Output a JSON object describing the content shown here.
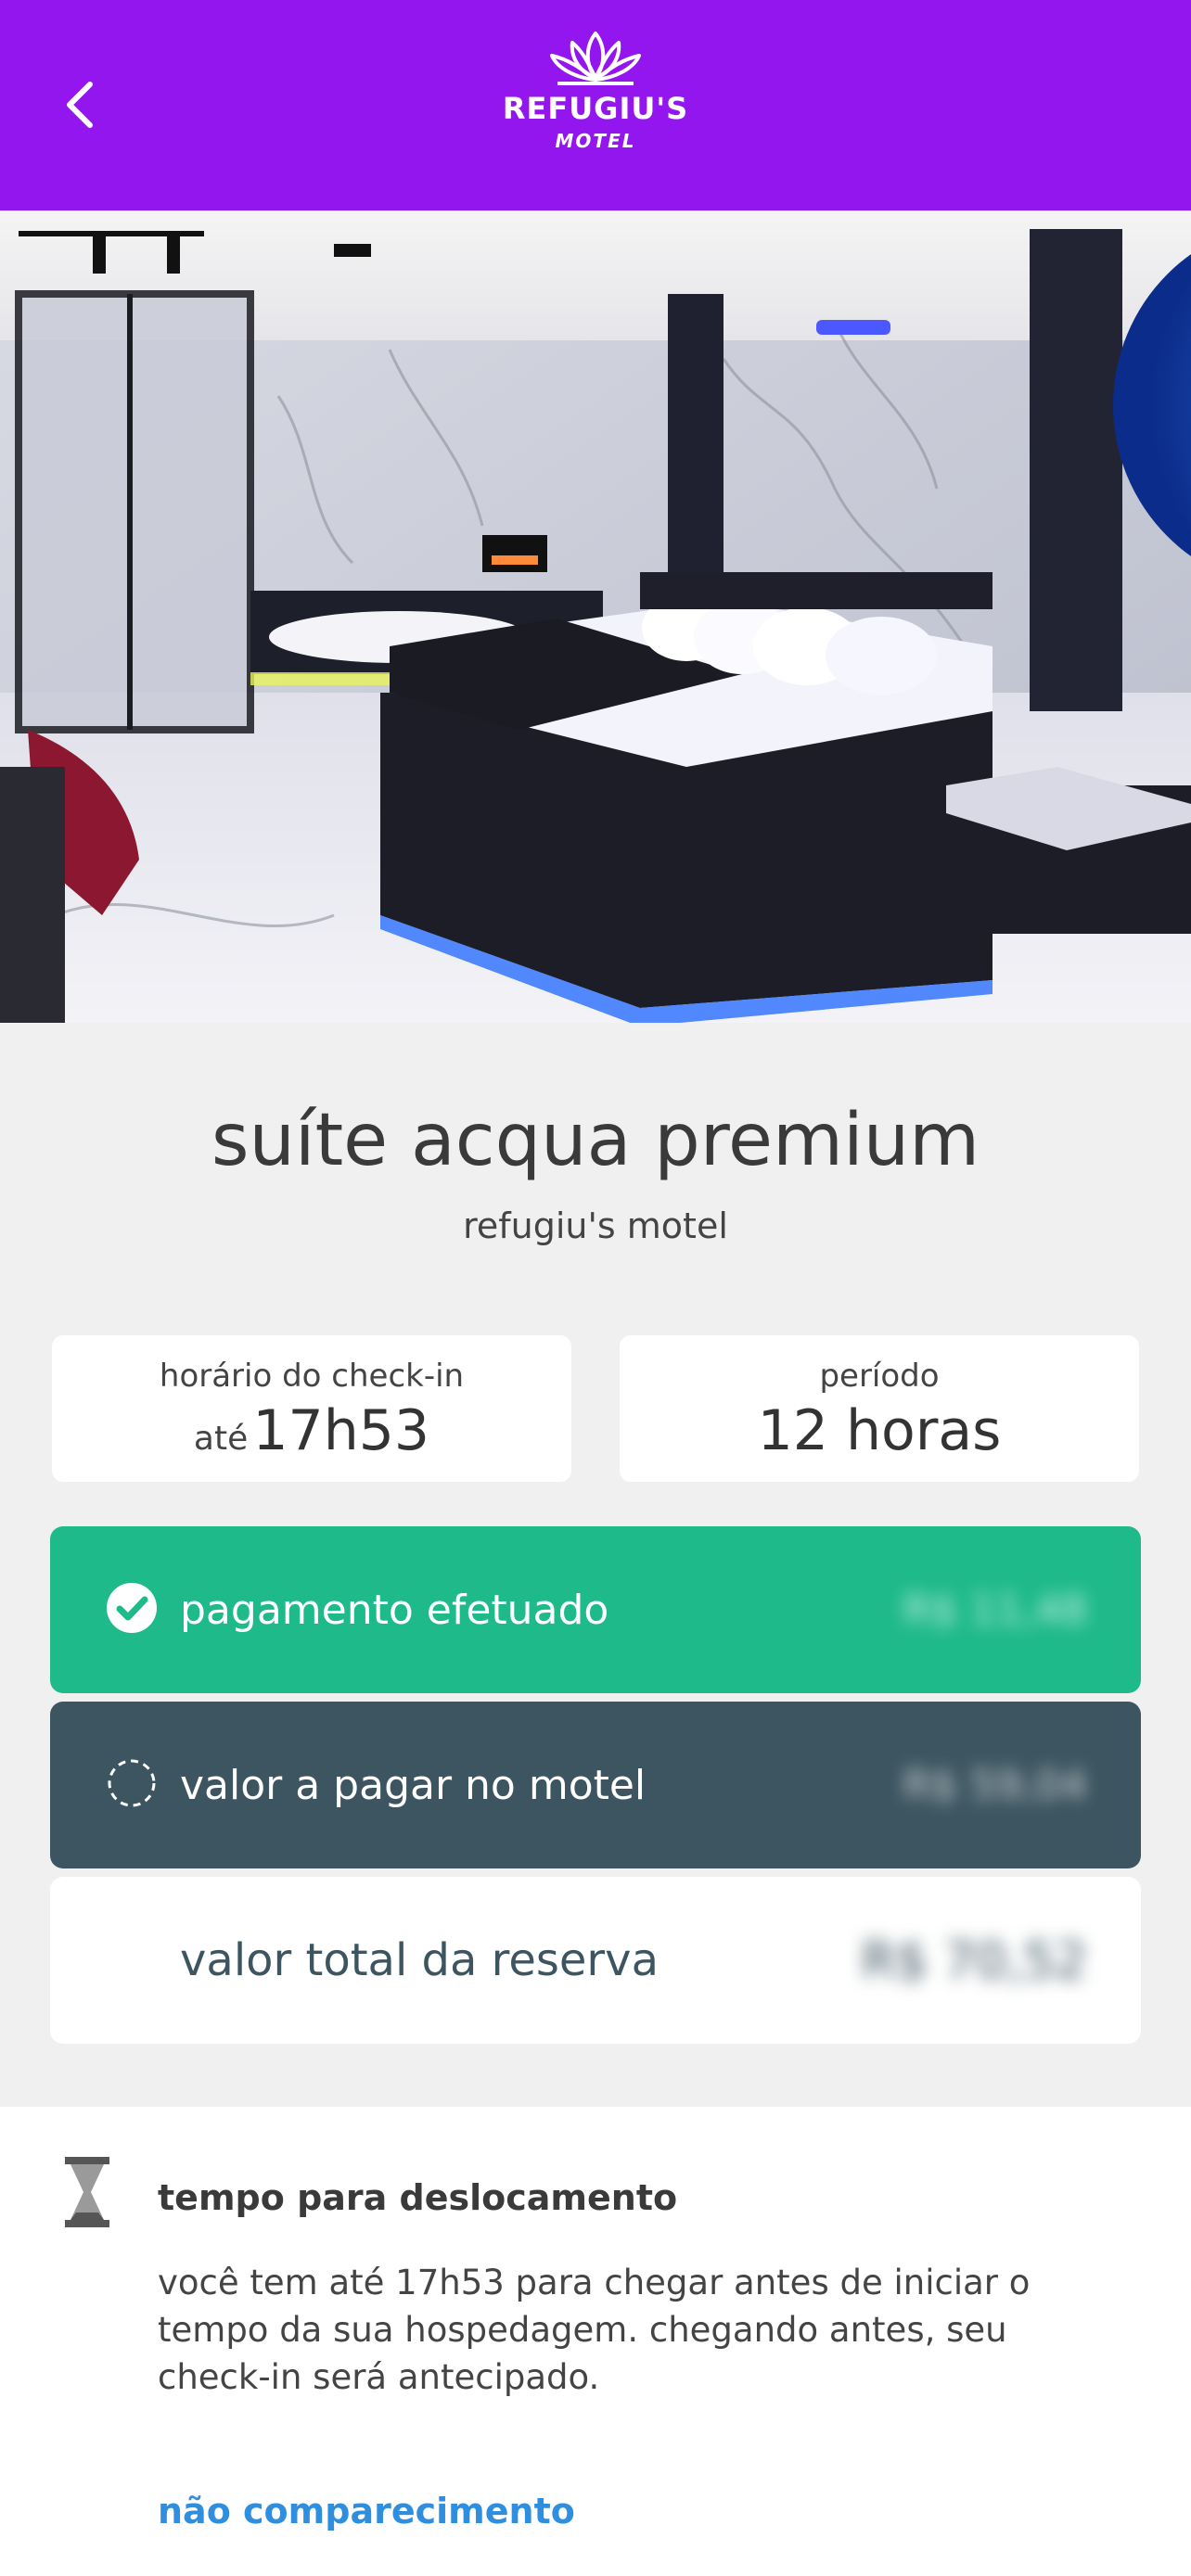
{
  "header": {
    "brand_name": "REFUGIU'S",
    "brand_sub": "MOTEL",
    "background_color": "#9316ee",
    "back_icon": "chevron-left-icon",
    "logo_icon": "lotus-icon"
  },
  "hero": {
    "image_subject": "suite photo"
  },
  "suite": {
    "title": "suíte acqua premium",
    "motel_name": "refugiu's motel"
  },
  "checkin": {
    "label": "horário do check-in",
    "prefix": "até",
    "time": "17h53"
  },
  "period": {
    "label": "período",
    "value": "12 horas"
  },
  "payments": [
    {
      "label": "pagamento efetuado",
      "amount": "R$ 11,48",
      "color": "#1fba8a",
      "icon": "check-circle-icon"
    },
    {
      "label": "valor a pagar no motel",
      "amount": "R$ 59,04",
      "color": "#3c5560",
      "icon": "dashed-circle-icon"
    },
    {
      "label": "valor total da reserva",
      "amount": "R$ 70,52",
      "color": "#ffffff"
    }
  ],
  "travel": {
    "icon": "hourglass-icon",
    "title": "tempo para deslocamento",
    "text": "você tem até 17h53 para chegar antes de iniciar o tempo da sua hospedagem. chegando antes, seu check-in será antecipado.",
    "no_show_link": "não comparecimento",
    "link_color": "#2f8fde"
  }
}
